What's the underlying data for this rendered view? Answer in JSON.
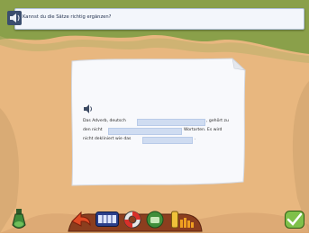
{
  "instruction": {
    "text": "Kannst du die Sätze richtig ergänzen?"
  },
  "exercise": {
    "line1_before": "Das Adverb, deutsch",
    "line1_after": ", gehört zu",
    "line2_before": "den nicht",
    "line2_after": "Wortarten. Es wird",
    "line3_before": "nicht dekliniert wie das",
    "line3_after": ".",
    "gaps": [
      "",
      "",
      ""
    ]
  },
  "toolbar": {
    "icons": [
      "potion-icon",
      "back-arrow-icon",
      "film-strip-icon",
      "lifebuoy-icon",
      "green-button-icon",
      "progress-bars-icon",
      "checkmark-icon"
    ]
  },
  "colors": {
    "sand": "#e8b77f",
    "grass": "#8aa04a",
    "bar_border": "#aebfd6",
    "gap_fill": "#cfdcf1"
  }
}
